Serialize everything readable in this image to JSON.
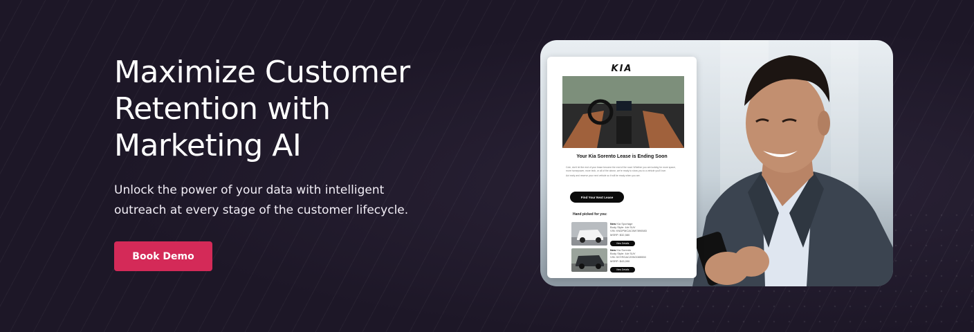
{
  "hero": {
    "title": "Maximize Customer Retention with Marketing AI",
    "subtitle": "Unlock the power of your data with intelligent outreach at every stage of the customer lifecycle.",
    "cta_label": "Book Demo",
    "accent_color": "#d42a58",
    "background_color": "#1d1727"
  },
  "email_preview": {
    "brand_logo": "KIA",
    "heading": "Your Kia Sorento Lease is Ending Soon",
    "body_paragraph_1": "Cole, don't let the end of your lease become the end of the road. Whether you are looking for more space, more horsepower, more tech, or all of the above, we're ready to show you to a vehicle you'll love.",
    "body_paragraph_2": "Act early and reserve your next vehicle so it will be ready when you are.",
    "cta_label": "Find Your Next Lease",
    "picks_heading": "Hand picked for you:",
    "vehicles": [
      {
        "condition": "New",
        "model": "Kia Sportage",
        "body_style": "Body Style: 4dr SUV",
        "vin": "VIN: KNDPMCAC0M7890583",
        "msrp": "MSRP: $32,580",
        "button_label": "View Details"
      },
      {
        "condition": "New",
        "model": "Kia Sorento",
        "body_style": "Body Style: 4dr SUV",
        "vin": "VIN: 5XYRGAC20NG085550",
        "msrp": "MSRP: $43,090",
        "button_label": "View Details"
      }
    ]
  }
}
